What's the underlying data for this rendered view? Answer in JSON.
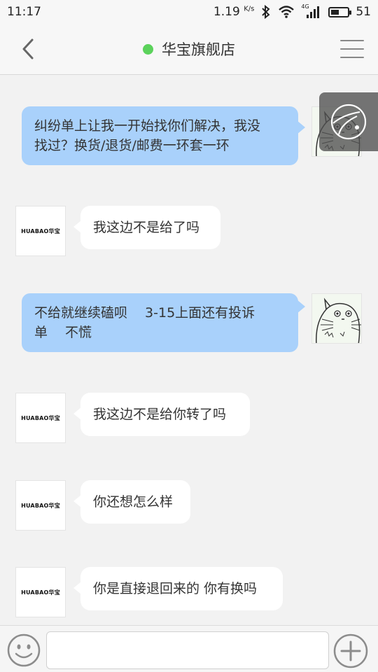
{
  "status_bar": {
    "time": "11:17",
    "network_speed": "1.19",
    "speed_unit": "K/s",
    "signal_type": "4G",
    "battery_level": "51",
    "icons": [
      "bluetooth-icon",
      "wifi-icon",
      "signal-icon",
      "battery-icon"
    ]
  },
  "header": {
    "title": "华宝旗舰店",
    "online_status_color": "#5bd25b",
    "back_icon": "chevron-left-icon",
    "menu_icon": "menu-icon"
  },
  "store_logo_text": "HUABAO华宝",
  "messages": [
    {
      "sender": "user",
      "lines": [
        "纠纷单上让我一开始找你们解决，我没",
        "找过？换货/退货/邮费一环套一环"
      ]
    },
    {
      "sender": "store",
      "text": "我这边不是给了吗"
    },
    {
      "sender": "user",
      "lines": [
        "不给就继续磕呗　 3-15上面还有投诉",
        "单　  不慌"
      ]
    },
    {
      "sender": "store",
      "text": "我这边不是给你转了吗"
    },
    {
      "sender": "store",
      "text": "你还想怎么样"
    },
    {
      "sender": "store",
      "text": "你是直接退回来的 你有换吗"
    }
  ],
  "input_bar": {
    "placeholder": "",
    "value": "",
    "emoji_icon": "emoji-icon",
    "add_icon": "plus-circle-icon"
  },
  "colors": {
    "outgoing_bubble": "#a9d1fb",
    "incoming_bubble": "#ffffff",
    "background": "#f2f2f2"
  }
}
